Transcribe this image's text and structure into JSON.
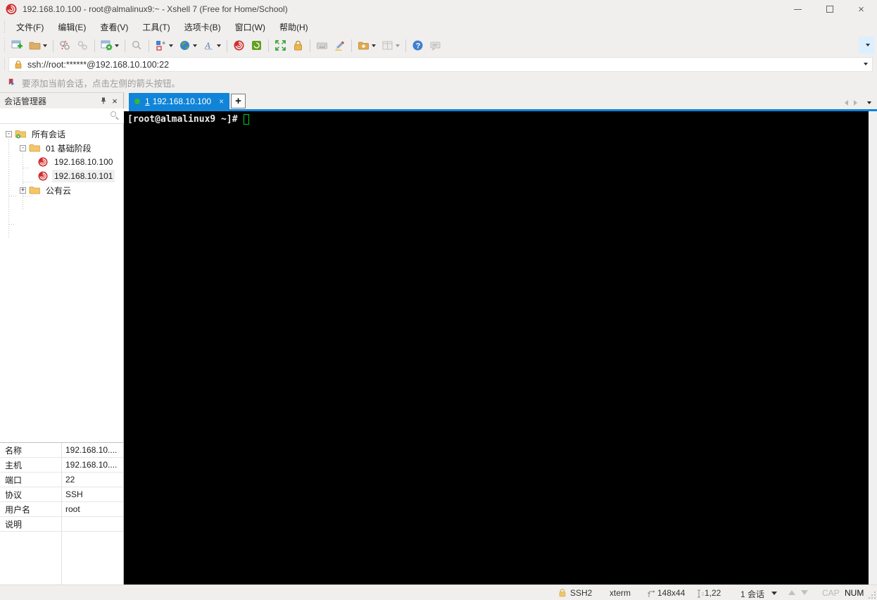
{
  "window": {
    "title": "192.168.10.100 - root@almalinux9:~ - Xshell 7 (Free for Home/School)",
    "close_glyph": "×"
  },
  "menu": {
    "items": [
      {
        "label": "文件(F)"
      },
      {
        "label": "编辑(E)"
      },
      {
        "label": "查看(V)"
      },
      {
        "label": "工具(T)"
      },
      {
        "label": "选项卡(B)"
      },
      {
        "label": "窗口(W)"
      },
      {
        "label": "帮助(H)"
      }
    ]
  },
  "toolbar": {
    "icons": [
      "new-session-icon",
      "open-folder-icon",
      "disconnect-icon",
      "reconnect-icon",
      "session-properties-icon",
      "find-icon",
      "compose-pane-icon",
      "encoding-globe-icon",
      "font-icon",
      "xshell-icon",
      "xftp-icon",
      "fullscreen-icon",
      "lock-icon",
      "virtual-keyboard-icon",
      "highlighter-icon",
      "new-file-icon",
      "layout-icon",
      "help-icon",
      "feedback-icon",
      "toolbar-overflow-icon"
    ]
  },
  "address_bar": {
    "value": "ssh://root:******@192.168.10.100:22"
  },
  "info_bar": {
    "text": "要添加当前会话，点击左侧的箭头按钮。"
  },
  "session_manager": {
    "title": "会话管理器",
    "search_placeholder": "",
    "tree": [
      {
        "label": "所有会话",
        "expander": "-",
        "icon": "root-folder"
      },
      {
        "label": "01 基础阶段",
        "expander": "-",
        "icon": "folder"
      },
      {
        "label": "192.168.10.100",
        "icon": "session"
      },
      {
        "label": "192.168.10.101",
        "icon": "session"
      },
      {
        "label": "公有云",
        "expander": "+",
        "icon": "folder"
      }
    ]
  },
  "tabs": {
    "active": {
      "index_label": "1",
      "label": "192.168.10.100",
      "close_glyph": "×",
      "status_color": "#35b53a"
    },
    "new_tab_label": "+"
  },
  "terminal": {
    "prompt": "[root@almalinux9 ~]#",
    "cursor_color": "#00cc22",
    "background": "#000000"
  },
  "properties": {
    "rows": [
      {
        "label": "名称",
        "value": "192.168.10...."
      },
      {
        "label": "主机",
        "value": "192.168.10...."
      },
      {
        "label": "端口",
        "value": "22"
      },
      {
        "label": "协议",
        "value": "SSH"
      },
      {
        "label": "用户名",
        "value": "root"
      },
      {
        "label": "说明",
        "value": ""
      }
    ]
  },
  "status_bar": {
    "protocol": "SSH2",
    "terminal_type": "xterm",
    "size": "148x44",
    "cursor_pos": "1,22",
    "sessions": "1 会话",
    "cap": "CAP",
    "num": "NUM"
  },
  "colors": {
    "accent_blue": "#1084d8",
    "tab_green_dot": "#35b53a",
    "terminal_green": "#00cc22",
    "xshell_red": "#cf2e2e",
    "xftp_green": "#63a11e",
    "folder_yellow": "#f5c569",
    "lock_gold": "#edb54d"
  }
}
